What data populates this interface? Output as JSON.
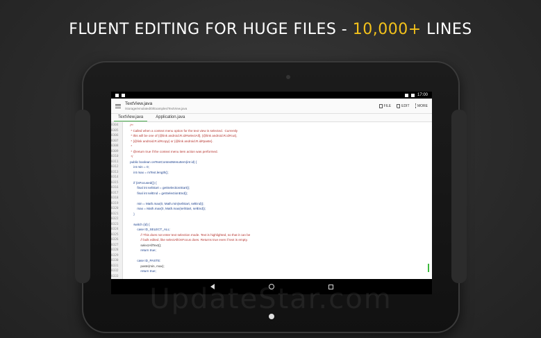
{
  "headline": {
    "main": "FLUENT EDITING FOR HUGE FILES - ",
    "accent": "10,000+",
    "tail": " LINES"
  },
  "statusbar": {
    "time": "17:00"
  },
  "appbar": {
    "file_title": "TextView.java",
    "file_path": "/storage/emulated/0/Examples/TextView.java",
    "actions": {
      "file": "FILE",
      "edit": "EDIT",
      "more": "MORE"
    }
  },
  "tabs": [
    "TextView.java",
    "Application.java"
  ],
  "editor": {
    "lines": [
      {
        "n": "8304",
        "t": "    /**",
        "c": "cm"
      },
      {
        "n": "8305",
        "t": "     * Called when a context menu option for the text view is selected.  Currently",
        "c": "cm"
      },
      {
        "n": "8306",
        "t": "     * this will be one of {@link android.R.id#selectAll}, {@link android.R.id#cut},",
        "c": "cm"
      },
      {
        "n": "8307",
        "t": "     * {@link android.R.id#copy} or {@link android.R.id#paste}.",
        "c": "cm"
      },
      {
        "n": "8308",
        "t": "     *",
        "c": "cm"
      },
      {
        "n": "8309",
        "t": "     * @return true if the context menu item action was performed.",
        "c": "cm"
      },
      {
        "n": "8310",
        "t": "     */",
        "c": "cm"
      },
      {
        "n": "8311",
        "t": "    public boolean onTextContextMenuItem(int id) {",
        "c": "kw"
      },
      {
        "n": "8312",
        "t": "        int min = 0;",
        "c": "kw"
      },
      {
        "n": "8313",
        "t": "        int max = mText.length();",
        "c": "kw"
      },
      {
        "n": "8314",
        "t": "",
        "c": ""
      },
      {
        "n": "8315",
        "t": "        if (isFocused()) {",
        "c": "kw"
      },
      {
        "n": "8316",
        "t": "            final int selStart = getSelectionStart();",
        "c": "kw"
      },
      {
        "n": "8317",
        "t": "            final int selEnd = getSelectionEnd();",
        "c": "kw"
      },
      {
        "n": "8318",
        "t": "",
        "c": ""
      },
      {
        "n": "8319",
        "t": "            min = Math.max(0, Math.min(selStart, selEnd));",
        "c": "kw"
      },
      {
        "n": "8320",
        "t": "            max = Math.max(0, Math.max(selStart, selEnd));",
        "c": "kw"
      },
      {
        "n": "8321",
        "t": "        }",
        "c": "kw"
      },
      {
        "n": "8322",
        "t": "",
        "c": ""
      },
      {
        "n": "8323",
        "t": "        switch (id) {",
        "c": "kw"
      },
      {
        "n": "8324",
        "t": "            case ID_SELECT_ALL:",
        "c": "kw"
      },
      {
        "n": "8325",
        "t": "                // This does not enter text selection mode. Text is highlighted, so that it can be",
        "c": "cm"
      },
      {
        "n": "8326",
        "t": "                // bulk edited, like selectAllOnFocus does. Returns true even if text is empty.",
        "c": "cm"
      },
      {
        "n": "8327",
        "t": "                selectAllText();",
        "c": ""
      },
      {
        "n": "8328",
        "t": "                return true;",
        "c": "kw"
      },
      {
        "n": "8329",
        "t": "",
        "c": ""
      },
      {
        "n": "8330",
        "t": "            case ID_PASTE:",
        "c": "kw"
      },
      {
        "n": "8331",
        "t": "                paste(min, max);",
        "c": ""
      },
      {
        "n": "8332",
        "t": "                return true;",
        "c": "kw"
      },
      {
        "n": "8333",
        "t": "",
        "c": ""
      }
    ]
  },
  "watermark": "UpdateStar.com",
  "colors": {
    "accent": "#f4c21b",
    "tab_indicator": "#4caf50",
    "comment": "#b5332d",
    "keyword": "#1a3f8c"
  },
  "icons": [
    "menu-icon",
    "file-icon",
    "edit-icon",
    "more-icon",
    "back-icon",
    "home-icon",
    "recents-icon"
  ]
}
